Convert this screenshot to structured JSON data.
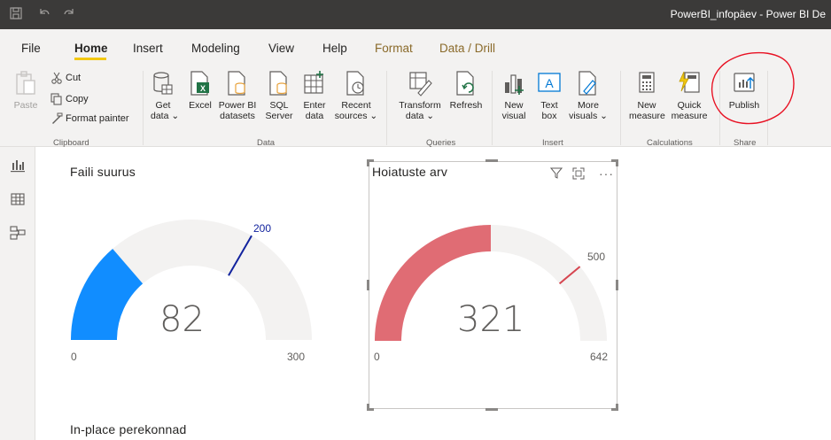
{
  "window": {
    "title": "PowerBI_infopäev - Power BI De",
    "icons": [
      "save-icon",
      "undo-icon",
      "redo-icon"
    ]
  },
  "menu": {
    "tabs": [
      "File",
      "Home",
      "Insert",
      "Modeling",
      "View",
      "Help",
      "Format",
      "Data / Drill"
    ],
    "active": "Home"
  },
  "ribbon": {
    "clipboard": {
      "paste": "Paste",
      "cut": "Cut",
      "copy": "Copy",
      "format_painter": "Format painter",
      "group": "Clipboard"
    },
    "data": {
      "get_data": [
        "Get",
        "data ⌄"
      ],
      "excel": [
        "Excel"
      ],
      "powerbi_datasets": [
        "Power BI",
        "datasets"
      ],
      "sql_server": [
        "SQL",
        "Server"
      ],
      "enter_data": [
        "Enter",
        "data"
      ],
      "recent_sources": [
        "Recent",
        "sources ⌄"
      ],
      "group": "Data"
    },
    "queries": {
      "transform_data": [
        "Transform",
        "data ⌄"
      ],
      "refresh": [
        "Refresh"
      ],
      "group": "Queries"
    },
    "insert": {
      "new_visual": [
        "New",
        "visual"
      ],
      "text_box": [
        "Text",
        "box"
      ],
      "more_visuals": [
        "More",
        "visuals ⌄"
      ],
      "group": "Insert"
    },
    "calculations": {
      "new_measure": [
        "New",
        "measure"
      ],
      "quick_measure": [
        "Quick",
        "measure"
      ],
      "group": "Calculations"
    },
    "share": {
      "publish": [
        "Publish"
      ],
      "group": "Share"
    }
  },
  "leftpane": {
    "icons": [
      "report-view-icon",
      "data-view-icon",
      "model-view-icon"
    ]
  },
  "visuals": {
    "gauge1": {
      "title": "Faili suurus",
      "value": "82",
      "min": "0",
      "max": "300",
      "target": "200",
      "color": "#118dff",
      "target_color": "#12239e"
    },
    "gauge2": {
      "title": "Hoiatuste arv",
      "value": "321",
      "min": "0",
      "max": "642",
      "target": "500",
      "color": "#e06c74",
      "target_color": "#d64550"
    },
    "table1": {
      "title": "In-place perekonnad"
    }
  },
  "colors": {
    "titlebar": "#3b3a39",
    "ribbon": "#f3f2f1",
    "accent": "#f2c811",
    "annotation": "#e81123"
  }
}
